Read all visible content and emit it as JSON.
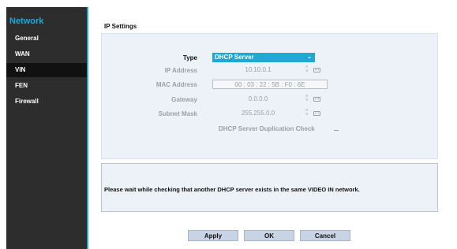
{
  "sidebar": {
    "title": "Network",
    "items": [
      {
        "label": "General"
      },
      {
        "label": "WAN"
      },
      {
        "label": "VIN"
      },
      {
        "label": "FEN"
      },
      {
        "label": "Firewall"
      }
    ],
    "active_index": 2,
    "accent_color": "#1ea8d8"
  },
  "main": {
    "section_title": "IP Settings",
    "type": {
      "label": "Type",
      "value": "DHCP Server"
    },
    "ip_address": {
      "label": "IP Address",
      "value": "10.10.0.1"
    },
    "mac_address": {
      "label": "MAC Address",
      "value": "00 : 03 : 22 : 5B : F0 : 6E"
    },
    "gateway": {
      "label": "Gateway",
      "value": "0.0.0.0"
    },
    "subnet_mask": {
      "label": "Subnet Mask",
      "value": "255.255.0.0"
    },
    "dhcp_dup_check": {
      "label": "DHCP Server Duplication Check",
      "checked": false
    },
    "message": "Please wait while checking that another DHCP server exists in the same VIDEO IN network."
  },
  "buttons": {
    "apply": "Apply",
    "ok": "OK",
    "cancel": "Cancel"
  }
}
